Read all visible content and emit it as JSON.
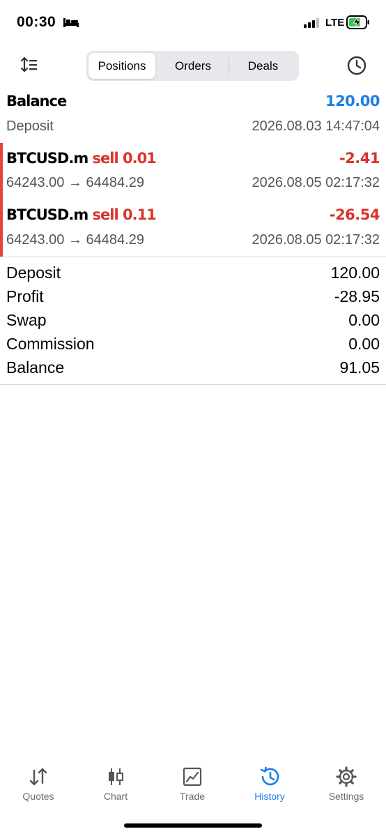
{
  "status": {
    "time": "00:30",
    "network": "LTE"
  },
  "tabs": {
    "positions": "Positions",
    "orders": "Orders",
    "deals": "Deals"
  },
  "balance_row": {
    "title": "Balance",
    "amount": "120.00",
    "type": "Deposit",
    "datetime": "2026.08.03 14:47:04"
  },
  "positions": [
    {
      "symbol": "BTCUSD.m",
      "side": "sell 0.01",
      "profit": "-2.41",
      "prices": "64243.00 → 64484.29",
      "datetime": "2026.08.05 02:17:32"
    },
    {
      "symbol": "BTCUSD.m",
      "side": "sell 0.11",
      "profit": "-26.54",
      "prices": "64243.00 → 64484.29",
      "datetime": "2026.08.05 02:17:32"
    }
  ],
  "summary": [
    {
      "label": "Deposit",
      "value": "120.00"
    },
    {
      "label": "Profit",
      "value": "-28.95"
    },
    {
      "label": "Swap",
      "value": "0.00"
    },
    {
      "label": "Commission",
      "value": "0.00"
    },
    {
      "label": "Balance",
      "value": "91.05"
    }
  ],
  "nav": [
    {
      "label": "Quotes",
      "icon": "quotes-icon"
    },
    {
      "label": "Chart",
      "icon": "chart-icon"
    },
    {
      "label": "Trade",
      "icon": "trade-icon"
    },
    {
      "label": "History",
      "icon": "history-icon",
      "active": true
    },
    {
      "label": "Settings",
      "icon": "settings-icon"
    }
  ],
  "colors": {
    "accent": "#1a7ee8",
    "loss": "#d9342b",
    "marker": "#e0463d"
  }
}
